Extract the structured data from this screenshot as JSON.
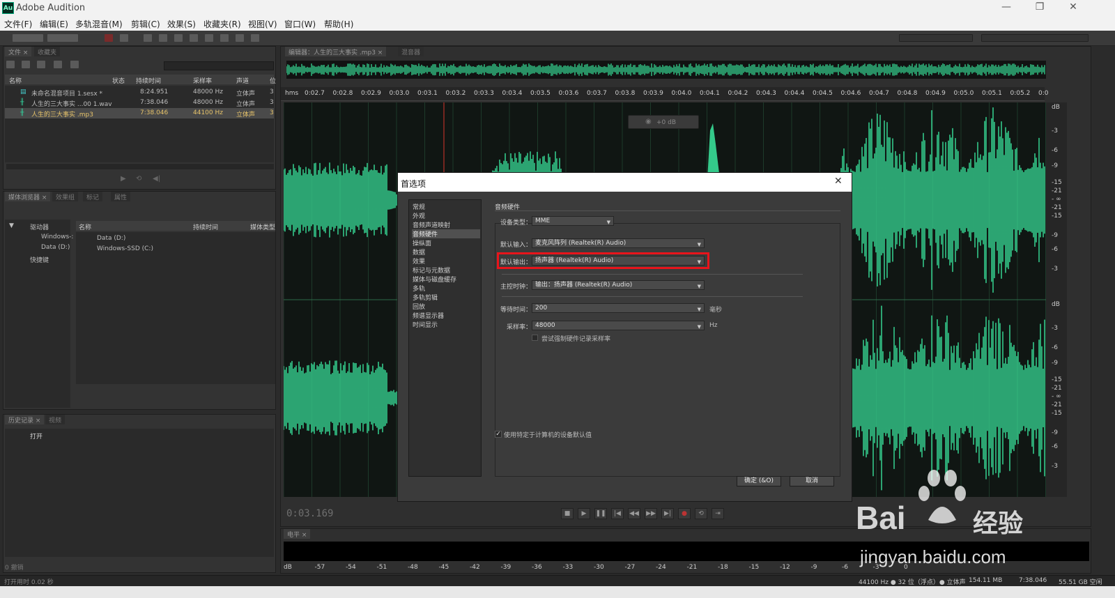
{
  "app": {
    "title": "Adobe Audition",
    "logo": "Au"
  },
  "menu": [
    "文件(F)",
    "编辑(E)",
    "多轨混音(M)",
    "剪辑(C)",
    "效果(S)",
    "收藏夹(R)",
    "视图(V)",
    "窗口(W)",
    "帮助(H)"
  ],
  "files_panel": {
    "columns": [
      "名称",
      "状态",
      "持续时间",
      "采样率",
      "声道",
      "位"
    ],
    "rows": [
      {
        "name": "未命名混音项目 1.sesx *",
        "duration": "8:24.951",
        "rate": "48000 Hz",
        "channels": "立体声",
        "bits": "3"
      },
      {
        "name": "人生的三大事实 ...00 1.wav",
        "duration": "7:38.046",
        "rate": "48000 Hz",
        "channels": "立体声",
        "bits": "3"
      },
      {
        "name": "人生的三大事实 .mp3",
        "duration": "7:38.046",
        "rate": "44100 Hz",
        "channels": "立体声",
        "bits": "3"
      }
    ]
  },
  "media_panel": {
    "tree": [
      "驱动器",
      "Windows-:",
      "Data (D:)",
      "快捷键"
    ],
    "columns": [
      "名称",
      "持续时间",
      "媒体类型"
    ],
    "rows": [
      "Data (D:)",
      "Windows-SSD (C:)"
    ]
  },
  "history_panel": {
    "items": [
      "打开"
    ],
    "footer": "0 撤销"
  },
  "editor": {
    "ruler_unit": "hms",
    "ticks": [
      "0:02.7",
      "0:02.8",
      "0:02.9",
      "0:03.0",
      "0:03.1",
      "0:03.2",
      "0:03.3",
      "0:03.4",
      "0:03.5",
      "0:03.6",
      "0:03.7",
      "0:03.8",
      "0:03.9",
      "0:04.0",
      "0:04.1",
      "0:04.2",
      "0:04.3",
      "0:04.4",
      "0:04.5",
      "0:04.6",
      "0:04.7",
      "0:04.8",
      "0:04.9",
      "0:05.0",
      "0:05.1",
      "0:05.2",
      "0:0"
    ],
    "db_top": [
      "dB",
      "-3",
      "-6",
      "-9",
      "-15",
      "-21",
      "- ∞",
      "-21",
      "-15",
      "-9",
      "-6",
      "-3"
    ],
    "db_bottom": [
      "dB",
      "-3",
      "-6",
      "-9",
      "-15",
      "-21",
      "- ∞",
      "-21",
      "-15",
      "-9",
      "-6",
      "-3"
    ],
    "hud_gain": "+0 dB",
    "timecode": "0:03.169"
  },
  "levels": {
    "scale": [
      "dB",
      "-57",
      "-54",
      "-51",
      "-48",
      "-45",
      "-42",
      "-39",
      "-36",
      "-33",
      "-30",
      "-27",
      "-24",
      "-21",
      "-18",
      "-15",
      "-12",
      "-9",
      "-6",
      "-3",
      "0"
    ]
  },
  "status": {
    "left": "打开用时 0.02 秒",
    "format": "44100 Hz ● 32 位（浮点）● 立体声",
    "size": "154.11 MB",
    "duration": "7:38.046",
    "free": "55.51 GB 空闲"
  },
  "dialog": {
    "title": "首选项",
    "categories": [
      "常规",
      "外观",
      "音频声道映射",
      "音频硬件",
      "操纵面",
      "数据",
      "效果",
      "标记与元数据",
      "媒体与磁盘缓存",
      "多轨",
      "多轨剪辑",
      "回放",
      "频谱显示器",
      "时间显示"
    ],
    "selected_index": 3,
    "section_title": "音频硬件",
    "device_type_label": "设备类型：",
    "device_type": "MME",
    "default_input_label": "默认输入：",
    "default_input": "麦克风阵列 (Realtek(R) Audio)",
    "default_output_label": "默认输出：",
    "default_output": "扬声器 (Realtek(R) Audio)",
    "master_clock_label": "主控时钟：",
    "master_clock": "输出：扬声器 (Realtek(R) Audio)",
    "latency_label": "等待时间：",
    "latency": "200",
    "latency_unit": "毫秒",
    "sample_rate_label": "采样率：",
    "sample_rate": "48000",
    "sample_rate_unit": "Hz",
    "force_rate_label": "尝试强制硬件记录采样率",
    "use_defaults_label": "使用特定于计算机的设备默认值",
    "ok_label": "确定 (&O)",
    "cancel_label": "取消",
    "highlight_color": "#e8141b"
  },
  "watermark": {
    "brand": "Bai",
    "brand2": "经验",
    "url": "jingyan.baidu.com"
  },
  "colors": {
    "waveform": "#34c98a",
    "playhead": "#d9342b"
  }
}
